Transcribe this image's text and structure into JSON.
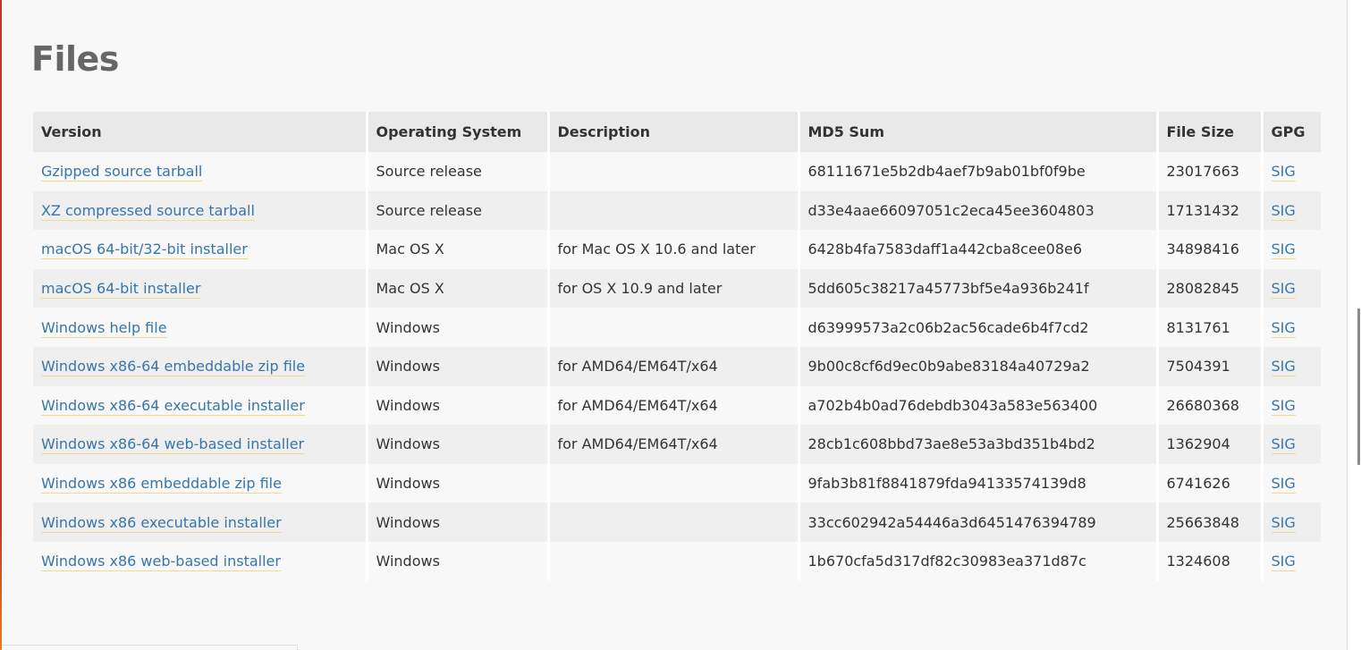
{
  "heading": "Files",
  "table": {
    "headers": [
      "Version",
      "Operating System",
      "Description",
      "MD5 Sum",
      "File Size",
      "GPG"
    ],
    "rows": [
      {
        "version": "Gzipped source tarball",
        "os": "Source release",
        "description": "",
        "md5": "68111671e5b2db4aef7b9ab01bf0f9be",
        "size": "23017663",
        "gpg": "SIG"
      },
      {
        "version": "XZ compressed source tarball",
        "os": "Source release",
        "description": "",
        "md5": "d33e4aae66097051c2eca45ee3604803",
        "size": "17131432",
        "gpg": "SIG"
      },
      {
        "version": "macOS 64-bit/32-bit installer",
        "os": "Mac OS X",
        "description": "for Mac OS X 10.6 and later",
        "md5": "6428b4fa7583daff1a442cba8cee08e6",
        "size": "34898416",
        "gpg": "SIG"
      },
      {
        "version": "macOS 64-bit installer",
        "os": "Mac OS X",
        "description": "for OS X 10.9 and later",
        "md5": "5dd605c38217a45773bf5e4a936b241f",
        "size": "28082845",
        "gpg": "SIG"
      },
      {
        "version": "Windows help file",
        "os": "Windows",
        "description": "",
        "md5": "d63999573a2c06b2ac56cade6b4f7cd2",
        "size": "8131761",
        "gpg": "SIG"
      },
      {
        "version": "Windows x86-64 embeddable zip file",
        "os": "Windows",
        "description": "for AMD64/EM64T/x64",
        "md5": "9b00c8cf6d9ec0b9abe83184a40729a2",
        "size": "7504391",
        "gpg": "SIG"
      },
      {
        "version": "Windows x86-64 executable installer",
        "os": "Windows",
        "description": "for AMD64/EM64T/x64",
        "md5": "a702b4b0ad76debdb3043a583e563400",
        "size": "26680368",
        "gpg": "SIG"
      },
      {
        "version": "Windows x86-64 web-based installer",
        "os": "Windows",
        "description": "for AMD64/EM64T/x64",
        "md5": "28cb1c608bbd73ae8e53a3bd351b4bd2",
        "size": "1362904",
        "gpg": "SIG"
      },
      {
        "version": "Windows x86 embeddable zip file",
        "os": "Windows",
        "description": "",
        "md5": "9fab3b81f8841879fda94133574139d8",
        "size": "6741626",
        "gpg": "SIG"
      },
      {
        "version": "Windows x86 executable installer",
        "os": "Windows",
        "description": "",
        "md5": "33cc602942a54446a3d6451476394789",
        "size": "25663848",
        "gpg": "SIG"
      },
      {
        "version": "Windows x86 web-based installer",
        "os": "Windows",
        "description": "",
        "md5": "1b670cfa5d317df82c30983ea371d87c",
        "size": "1324608",
        "gpg": "SIG"
      }
    ]
  },
  "colors": {
    "link": "#3776ab",
    "link_underline": "#f2d98d",
    "header_bg": "#e9e9e9",
    "row_alt_bg": "#efefef",
    "page_bg": "#f8f8f8",
    "heading": "#666666"
  }
}
